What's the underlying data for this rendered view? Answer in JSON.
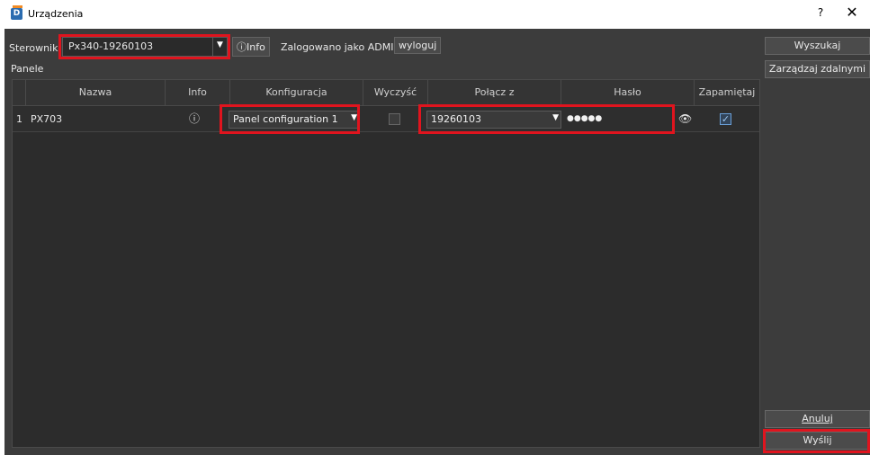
{
  "window": {
    "title": "Urządzenia",
    "app_icon_letter": "D",
    "help_label": "?",
    "close_label": "✕"
  },
  "controller": {
    "label": "Sterownik:",
    "selected": "Px340-19260103",
    "info_label": "Info",
    "logged_in_text": "Zalogowano jako ADMIN",
    "logout_label": "wyloguj"
  },
  "panels": {
    "label": "Panele",
    "columns": [
      "Nazwa",
      "Info",
      "Konfiguracja",
      "Wyczyść",
      "Połącz z",
      "Hasło",
      "Zapamiętaj"
    ],
    "rows": [
      {
        "index": "1",
        "name": "PX703",
        "info_icon": "ⓘ",
        "configuration": "Panel configuration 1",
        "clear_checked": false,
        "connect_to": "19260103",
        "password": "●●●●●",
        "remember_checked": true
      }
    ]
  },
  "sidebar": {
    "search_label": "Wyszukaj",
    "remote_label": "Zarządzaj zdalnymi",
    "cancel_label": "Anuluj",
    "send_label": "Wyślij"
  },
  "colors": {
    "highlight": "#e0141e",
    "background": "#3c3c3c"
  }
}
